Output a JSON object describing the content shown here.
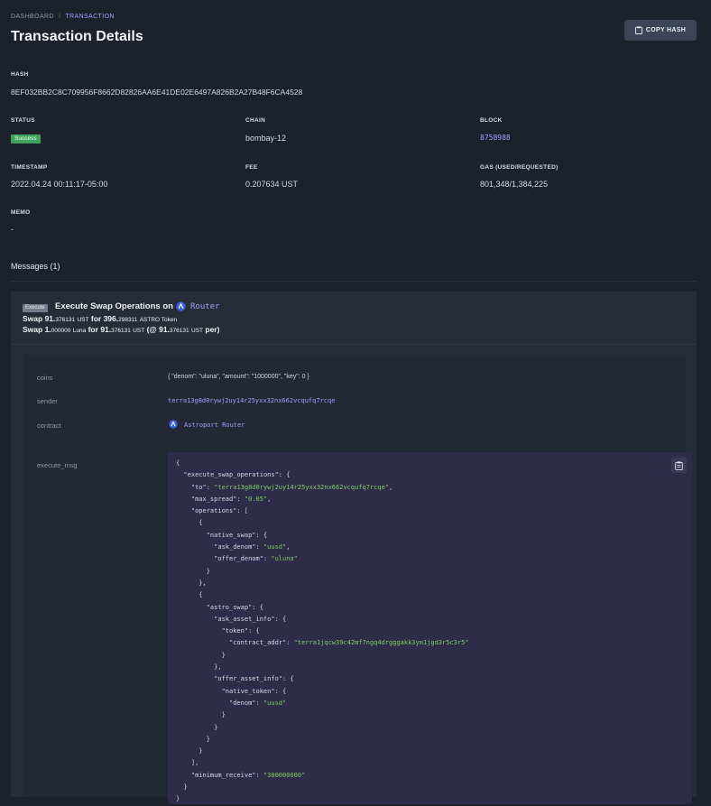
{
  "breadcrumb": {
    "root": "DASHBOARD",
    "separator": "/",
    "current": "TRANSACTION"
  },
  "page_title": "Transaction Details",
  "copy_button": {
    "label": "COPY HASH",
    "icon": "clipboard-icon"
  },
  "hash": {
    "label": "HASH",
    "value": "8EF032BB2C8C709956F8662D82826AA6E41DE02E6497A826B2A27B48F6CA4528"
  },
  "status": {
    "label": "STATUS",
    "value": "Success",
    "color": "#3da35d"
  },
  "chain": {
    "label": "CHAIN",
    "value": "bombay-12"
  },
  "block": {
    "label": "BLOCK",
    "value": "8758988"
  },
  "timestamp": {
    "label": "TIMESTAMP",
    "value": "2022.04.24 00:11:17-05:00"
  },
  "fee": {
    "label": "FEE",
    "value": "0.207634 UST"
  },
  "gas": {
    "label": "GAS (USED/REQUESTED)",
    "value": "801,348/1,384,225"
  },
  "memo": {
    "label": "MEMO",
    "value": "-"
  },
  "messages_title": "Messages (1)",
  "message": {
    "badge": "Execute",
    "title": "Execute Swap Operations on",
    "router_link": "Router",
    "swap1": {
      "word": "Swap",
      "amount_int": "91.",
      "amount_dec": "376131",
      "unit": "UST",
      "for": "for",
      "out_int": "396.",
      "out_dec": "298311",
      "out_unit": "ASTRO Token"
    },
    "swap2": {
      "word": "Swap",
      "amount_int": "1.",
      "amount_dec": "000000",
      "unit": "Luna",
      "for": "for",
      "out_int": "91.",
      "out_dec": "376131",
      "out_unit": "UST",
      "at_open": "(@",
      "rate_int": "91.",
      "rate_dec": "376131",
      "rate_unit": "UST",
      "per": "per)"
    },
    "rows": {
      "coins_label": "coins",
      "coins_value": "{ \"denom\": \"uluna\", \"amount\": \"1000000\", \"key\": 0 }",
      "sender_label": "sender",
      "sender_value": "terra13g8d0rywj2uy14r25yxx32nx662vcqufq7rcqe",
      "contract_label": "contract",
      "contract_value": "Astroport Router",
      "execute_label": "execute_msg"
    },
    "execute_msg": {
      "key_root": "execute_swap_operations",
      "to": "terra13g8d0rywj2uy14r25yxx32nx662vcqufq7rcqe",
      "max_spread": "0.05",
      "ask_denom": "uusd",
      "offer_denom": "uluna",
      "contract_addr": "terra1jqcw39c42mf7ngq4drgggakk3ym1jgd3r5c3r5",
      "offer_native_denom": "uusd",
      "minimum_receive": "300000000"
    }
  },
  "colors": {
    "background": "#1c212c",
    "accent": "#a79cff",
    "code_bg": "#2f2c49",
    "string": "#7cd05f"
  }
}
